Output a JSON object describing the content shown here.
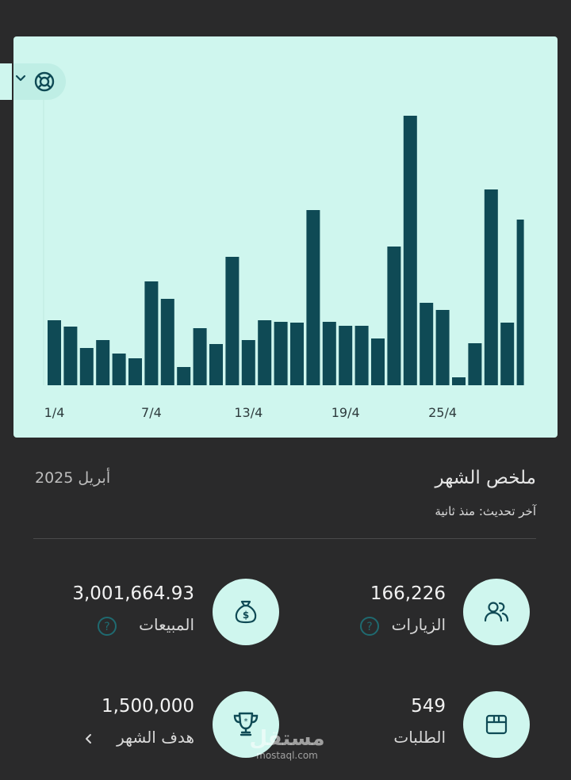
{
  "chart_data": {
    "type": "bar",
    "x_ticks": [
      "1/4",
      "7/4",
      "13/4",
      "19/4",
      "25/4"
    ],
    "days": [
      1,
      2,
      3,
      4,
      5,
      6,
      7,
      8,
      9,
      10,
      11,
      12,
      13,
      14,
      15,
      16,
      17,
      18,
      19,
      20,
      21,
      22,
      23,
      24,
      25,
      26,
      27,
      28,
      29,
      30
    ],
    "values": [
      82,
      74,
      47,
      57,
      40,
      34,
      131,
      109,
      23,
      72,
      52,
      162,
      57,
      82,
      80,
      79,
      221,
      80,
      75,
      75,
      59,
      175,
      340,
      104,
      95,
      10,
      53,
      247,
      79,
      209
    ],
    "grid": false,
    "color": "#0f4a55"
  },
  "summary": {
    "title": "ملخص الشهر",
    "date": "أبريل 2025",
    "updated": "آخر تحديث: منذ ثانية"
  },
  "stats": {
    "visits": {
      "value": "166,226",
      "label": "الزيارات",
      "icon": "users-icon"
    },
    "sales": {
      "value": "3,001,664.93",
      "label": "المبيعات",
      "icon": "money-bag-icon"
    },
    "orders": {
      "value": "549",
      "label": "الطلبات",
      "icon": "box-icon"
    },
    "goal": {
      "value": "1,500,000",
      "label": "هدف الشهر",
      "icon": "trophy-icon"
    }
  },
  "watermark": {
    "main": "مستقل",
    "sub": "mostaql.com"
  },
  "colors": {
    "background": "#2a2a2b",
    "chart_bg": "#cff6ee",
    "bar": "#0f4a55",
    "icon": "#0f4a55"
  }
}
